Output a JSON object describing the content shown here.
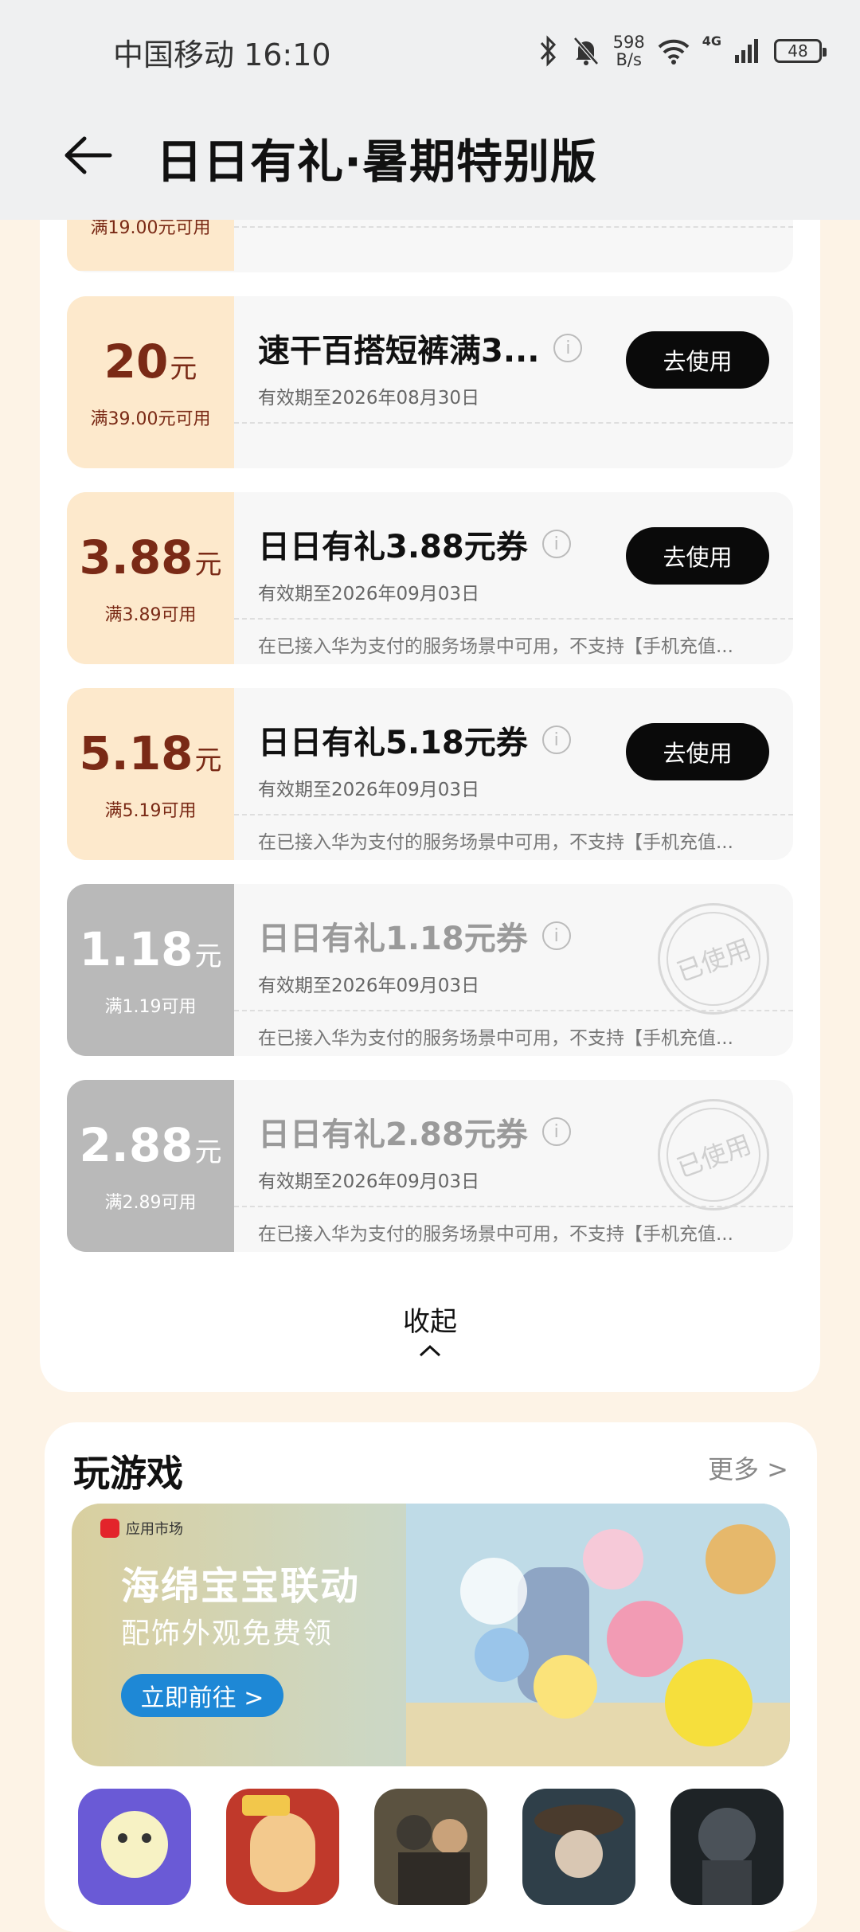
{
  "status_bar": {
    "carrier_time": "中国移动 16:10",
    "net_speed_value": "598",
    "net_speed_unit": "B/s",
    "network_type": "4G",
    "battery": "48"
  },
  "header": {
    "title": "日日有礼·暑期特别版"
  },
  "partial_coupon": {
    "condition": "满19.00元可用"
  },
  "coupons": [
    {
      "amount": "20",
      "unit": "元",
      "condition": "满39.00元可用",
      "name": "速干百搭短裤满3...",
      "valid": "有效期至2026年08月30日",
      "note": "",
      "action": "去使用",
      "used": false
    },
    {
      "amount": "3.88",
      "unit": "元",
      "condition": "满3.89可用",
      "name": "日日有礼3.88元券",
      "valid": "有效期至2026年09月03日",
      "note": "在已接入华为支付的服务场景中可用，不支持【手机充值...",
      "action": "去使用",
      "used": false
    },
    {
      "amount": "5.18",
      "unit": "元",
      "condition": "满5.19可用",
      "name": "日日有礼5.18元券",
      "valid": "有效期至2026年09月03日",
      "note": "在已接入华为支付的服务场景中可用，不支持【手机充值...",
      "action": "去使用",
      "used": false
    },
    {
      "amount": "1.18",
      "unit": "元",
      "condition": "满1.19可用",
      "name": "日日有礼1.18元券",
      "valid": "有效期至2026年09月03日",
      "note": "在已接入华为支付的服务场景中可用，不支持【手机充值...",
      "action": "已使用",
      "used": true
    },
    {
      "amount": "2.88",
      "unit": "元",
      "condition": "满2.89可用",
      "name": "日日有礼2.88元券",
      "valid": "有效期至2026年09月03日",
      "note": "在已接入华为支付的服务场景中可用，不支持【手机充值...",
      "action": "已使用",
      "used": true
    }
  ],
  "collapse_label": "收起",
  "games": {
    "title": "玩游戏",
    "more": "更多 >",
    "banner": {
      "market_label": "应用市场",
      "headline": "海绵宝宝联动",
      "subline": "配饰外观免费领",
      "cta": "立即前往 >"
    }
  },
  "colors": {
    "page_bg": "#fdf3e6",
    "coupon_amount_bg": "#fde9cc",
    "coupon_amount_text": "#7a2a16",
    "used_amount_bg": "#b9b9b9",
    "button_bg": "#0a0a0a",
    "banner_cta": "#1e88d6"
  }
}
